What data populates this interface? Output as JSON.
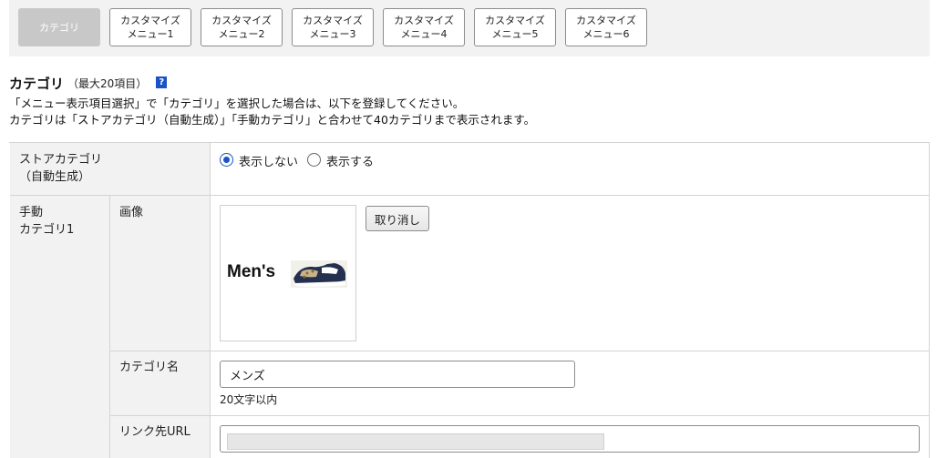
{
  "tabs": [
    {
      "line1": "カテゴリ",
      "line2": ""
    },
    {
      "line1": "カスタマイズ",
      "line2": "メニュー1"
    },
    {
      "line1": "カスタマイズ",
      "line2": "メニュー2"
    },
    {
      "line1": "カスタマイズ",
      "line2": "メニュー3"
    },
    {
      "line1": "カスタマイズ",
      "line2": "メニュー4"
    },
    {
      "line1": "カスタマイズ",
      "line2": "メニュー5"
    },
    {
      "line1": "カスタマイズ",
      "line2": "メニュー6"
    }
  ],
  "section": {
    "title": "カテゴリ",
    "note": "（最大20項目）",
    "help": "?",
    "desc1": "「メニュー表示項目選択」で「カテゴリ」を選択した場合は、以下を登録してください。",
    "desc2": "カテゴリは「ストアカテゴリ（自動生成）」「手動カテゴリ」と合わせて40カテゴリまで表示されます。"
  },
  "store_category": {
    "label1": "ストアカテゴリ",
    "label2": "（自動生成）",
    "options": [
      {
        "label": "表示しない",
        "selected": true
      },
      {
        "label": "表示する",
        "selected": false
      }
    ]
  },
  "manual_category": {
    "label1": "手動",
    "label2": "カテゴリ1",
    "image": {
      "label": "画像",
      "banner_text": "Men's",
      "cancel_label": "取り消し"
    },
    "name": {
      "label": "カテゴリ名",
      "value": "メンズ",
      "hint": "20文字以内"
    },
    "url": {
      "label": "リンク先URL",
      "value": ""
    }
  },
  "colors": {
    "accent": "#1a53c8",
    "label_bg": "#f2f2f2",
    "active_tab": "#c8c8c8"
  }
}
